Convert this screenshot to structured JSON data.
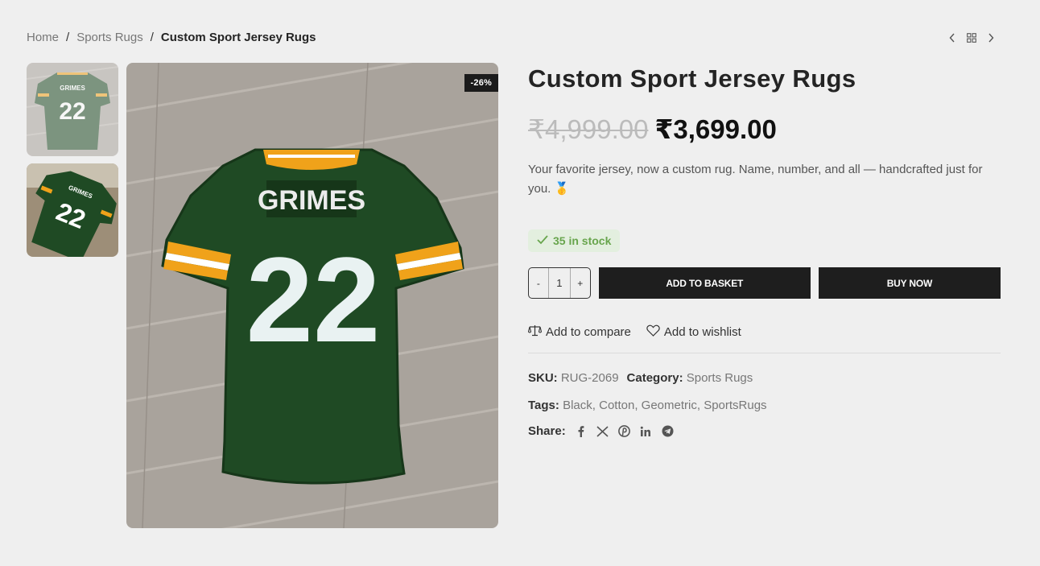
{
  "breadcrumb": {
    "home": "Home",
    "separator": "/",
    "category": "Sports Rugs",
    "current": "Custom Sport Jersey Rugs"
  },
  "product_nav": {
    "prev_icon": "chevron-left-icon",
    "grid_icon": "grid-icon",
    "next_icon": "chevron-right-icon"
  },
  "gallery": {
    "badge": "-26%",
    "main_jersey_name": "GRIMES",
    "main_jersey_number": "22",
    "thumb1_name": "GRIMES",
    "thumb1_number": "22",
    "thumb2_name": "GRIMES",
    "thumb2_number": "22"
  },
  "product": {
    "title": "Custom Sport Jersey Rugs",
    "old_price": "₹4,999.00",
    "new_price": "₹3,699.00",
    "description": "Your favorite jersey, now a custom rug. Name, number, and all — handcrafted just for you. 🥇",
    "stock": "35 in stock",
    "qty_minus": "-",
    "qty_value": "1",
    "qty_plus": "+",
    "add_to_basket": "ADD TO BASKET",
    "buy_now": "BUY NOW",
    "add_to_compare": "Add to compare",
    "add_to_wishlist": "Add to wishlist"
  },
  "meta": {
    "sku_label": "SKU:",
    "sku": "RUG-2069",
    "category_label": "Category:",
    "category": "Sports Rugs",
    "tags_label": "Tags:",
    "tags": [
      "Black",
      "Cotton",
      "Geometric",
      "SportsRugs"
    ],
    "share_label": "Share:"
  },
  "colors": {
    "jersey_green": "#1f4a24",
    "jersey_gold": "#f0a21a",
    "floor": "#a9a39c",
    "stock_green": "#68a54d",
    "button_dark": "#1e1e1e"
  }
}
